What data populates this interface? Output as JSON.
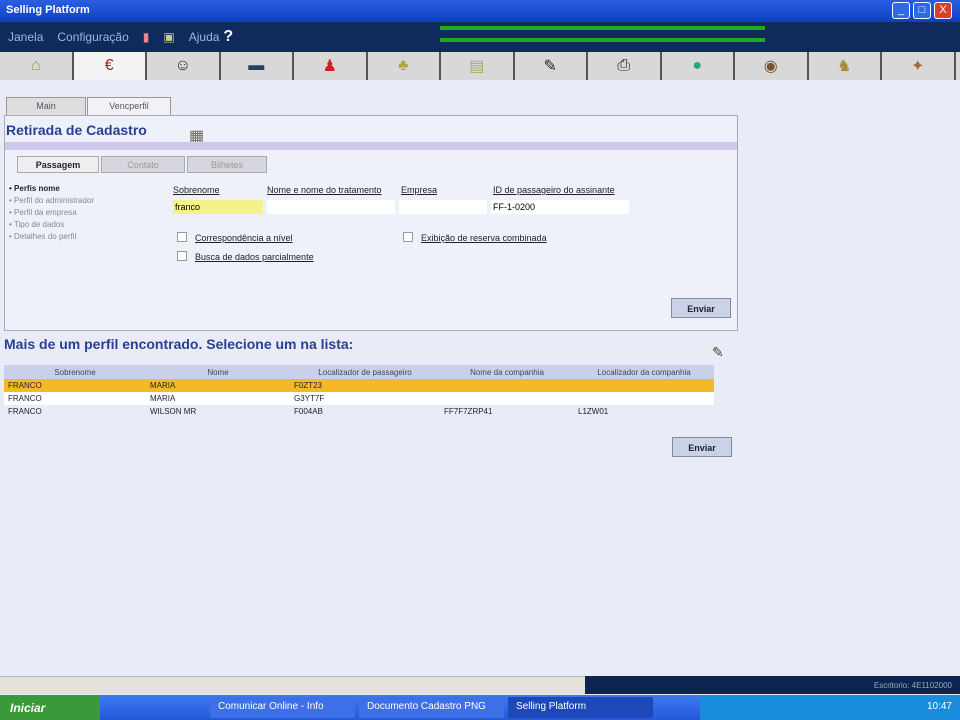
{
  "window": {
    "title": "Selling Platform",
    "min": "_",
    "max": "□",
    "close": "X"
  },
  "menu": {
    "items": [
      "Janela",
      "Configuração",
      "Ajuda"
    ],
    "help_glyph": "?"
  },
  "icon_tabs": [
    "home-icon",
    "euro-icon",
    "agent-icon",
    "car-icon",
    "person-icon",
    "tree-icon",
    "document-icon",
    "tools-icon",
    "printer-icon",
    "globe-icon",
    "stamp-icon",
    "figure-icon",
    "puzzle-icon"
  ],
  "sub_tabs": [
    "Main",
    "Vencperfil"
  ],
  "form": {
    "title": "Retirada de Cadastro",
    "tabs": [
      "Passagem",
      "Contato",
      "Bilhetes"
    ],
    "side_items": [
      "Perfis nome",
      "Perfil do administrador",
      "Perfil da empresa",
      "Tipo de dados",
      "Detalhes do perfil"
    ],
    "fields": [
      {
        "label": "Sobrenome",
        "value": "franco"
      },
      {
        "label": "Nome e nome do tratamento",
        "value": ""
      },
      {
        "label": "Empresa",
        "value": ""
      },
      {
        "label": "ID de passageiro do assinante",
        "value": "FF-1-0200"
      }
    ],
    "checkboxes": [
      "Correspondência a nível",
      "Busca de dados parcialmente",
      "Exibição de reserva combinada"
    ],
    "submit": "Enviar"
  },
  "results": {
    "heading": "Mais de um perfil encontrado. Selecione um na lista:",
    "columns": [
      "Sobrenome",
      "Nome",
      "Localizador de passageiro",
      "Nome da companhia",
      "Localizador da companhia"
    ],
    "rows": [
      [
        "FRANCO",
        "MARIA",
        "F0ZT23",
        "",
        ""
      ],
      [
        "FRANCO",
        "MARIA",
        "G3YT7F",
        "",
        ""
      ],
      [
        "FRANCO",
        "WILSON MR",
        "F004AB",
        "FF7F7ZRP41",
        "L1ZW01"
      ]
    ],
    "submit": "Enviar"
  },
  "statusbar": {
    "text": "Escritorio: 4E1102000"
  },
  "taskbar": {
    "start": "Iniciar",
    "tasks": [
      "Comunicar Online - Info",
      "Documento Cadastro PNG",
      "Selling Platform"
    ],
    "clock": "10:47"
  }
}
